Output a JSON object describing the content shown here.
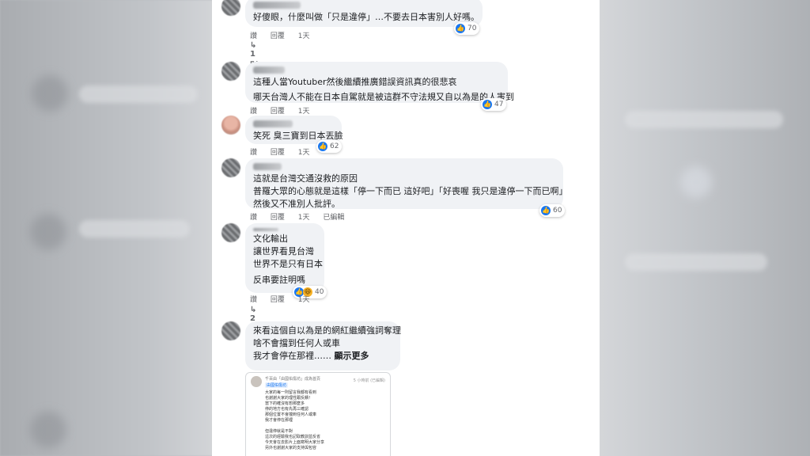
{
  "actions": {
    "like": "讚",
    "reply": "回覆"
  },
  "comments": [
    {
      "lines": [
        "好傻眼，什麼叫做「只是違停」…不要去日本害別人好嗎。"
      ],
      "time": "1天",
      "reactions": "70",
      "replies": "1則回覆"
    },
    {
      "lines": [
        "這種人當Youtuber然後繼續推廣錯誤資訊真的很悲哀",
        "哪天台灣人不能在日本自駕就是被這群不守法規又自以為是的人害到"
      ],
      "time": "1天",
      "reactions": "47"
    },
    {
      "lines": [
        "笑死 臭三寶到日本丟臉"
      ],
      "time": "1天",
      "reactions": "62"
    },
    {
      "lines": [
        "這就是台灣交通沒救的原因",
        "普羅大眾的心態就是這樣「停一下而已 這好吧」「好喪喔 我只是違停一下而已啊」",
        "然後又不准別人批評。"
      ],
      "time": "1天",
      "edited": "已編輯",
      "reactions": "60"
    },
    {
      "lines": [
        "文化輸出",
        "讓世界看見台灣",
        "世界不是只有日本",
        "反串要註明嗎"
      ],
      "time": "1天",
      "reactions": "40",
      "replies": "2則回覆"
    },
    {
      "lines": [
        "來看這個自以為是的網紅繼續強詞奪理",
        "啥不會擋到任何人或車",
        "我才會停在那裡……"
      ],
      "see_more": "顯示更多"
    }
  ],
  "embed": {
    "header": "千百由「由國佑傷坊」成為首頁",
    "tag": "由國佑傷坊",
    "time": "5 小時前 (已編輯)",
    "lines": [
      "大家的每一則留言我都有看到",
      "也謝謝大家的理性跟反饋！",
      "當下的確沒有想那麼多",
      "停的地方也有先再三確認",
      "那個位置不會擋到任何人或車",
      "我才會停在那裡",
      "",
      "但違停就是不對",
      "這次的經驗我也記取教訓並反省",
      "今天會在去影片上面寫明大家分享",
      "另外也謝謝大家的支持與包容"
    ]
  },
  "colors": {
    "accent": "#1877f2",
    "bubble": "#f0f2f5",
    "meta": "#65676b"
  }
}
